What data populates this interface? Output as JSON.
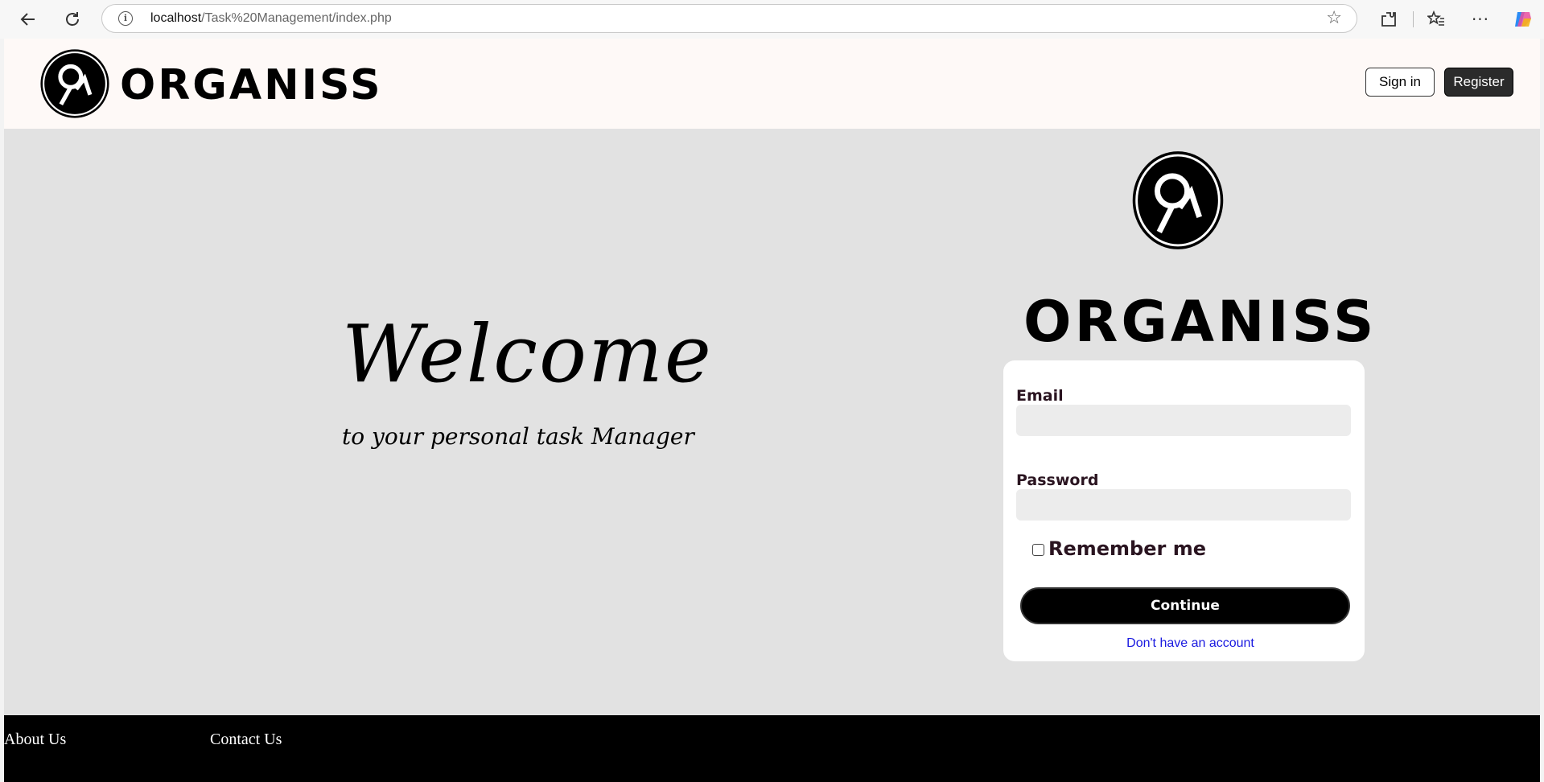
{
  "browser": {
    "url_host": "localhost",
    "url_path": "/Task%20Management/index.php"
  },
  "header": {
    "brand": "ORGANISS",
    "signin_label": "Sign in",
    "register_label": "Register"
  },
  "hero": {
    "title": "Welcome",
    "subtitle": "to your personal task Manager"
  },
  "login": {
    "brand": "ORGANISS",
    "email_label": "Email",
    "email_value": "",
    "password_label": "Password",
    "password_value": "",
    "remember_label": "Remember me",
    "remember_checked": false,
    "continue_label": "Continue",
    "register_link": "Don't have an account"
  },
  "footer": {
    "about": "About Us",
    "contact": "Contact Us"
  },
  "colors": {
    "header_bg": "#fef9f7",
    "page_bg": "#e2e2e2",
    "footer_bg": "#000000",
    "link": "#1a1ae0",
    "label": "#2a1420"
  }
}
